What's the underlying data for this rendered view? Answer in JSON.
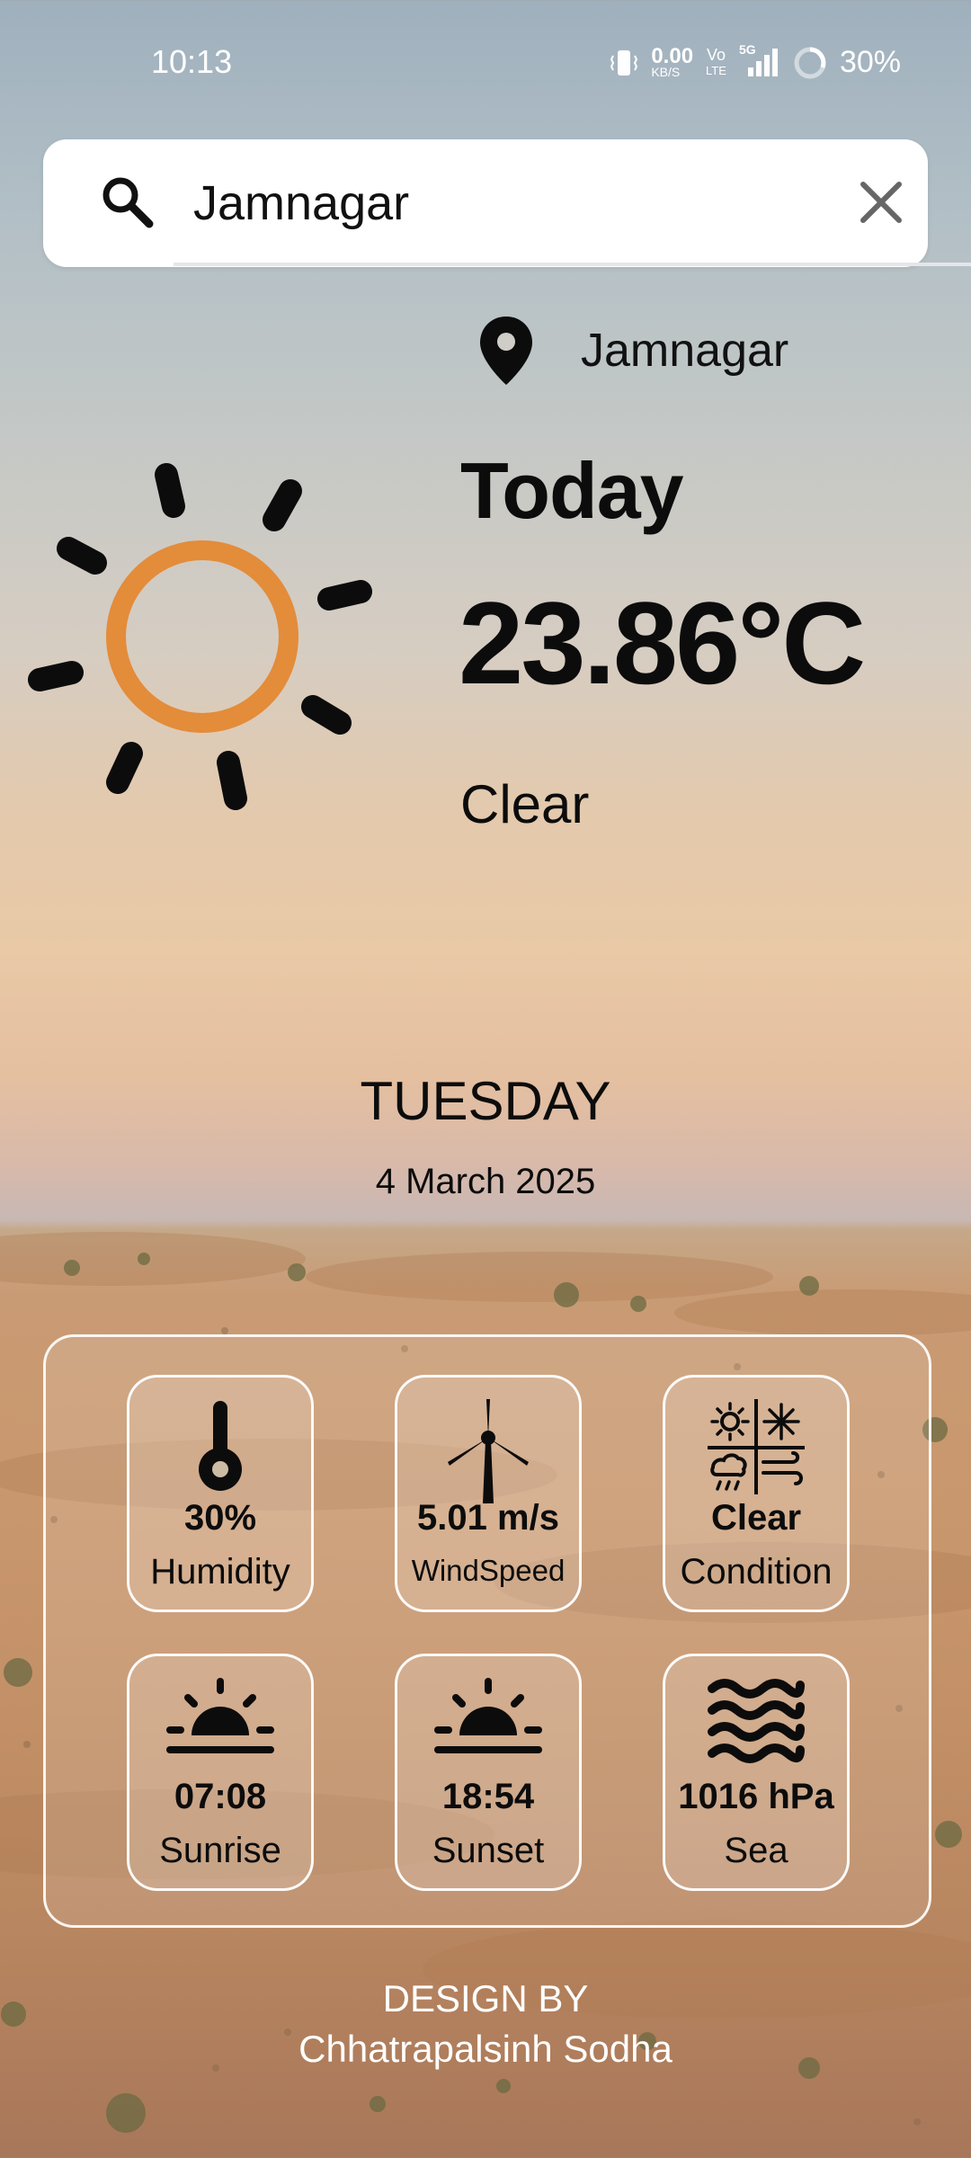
{
  "status_bar": {
    "time": "10:13",
    "net_speed_value": "0.00",
    "net_speed_unit": "KB/S",
    "volte_top": "Vo",
    "volte_bottom": "LTE",
    "network": "5G",
    "battery": "30%"
  },
  "search": {
    "value": "Jamnagar",
    "search_icon": "search-icon",
    "clear_icon": "close-icon"
  },
  "location": {
    "name": "Jamnagar",
    "icon": "location-pin-icon"
  },
  "weather": {
    "icon": "sun-icon",
    "day_label": "Today",
    "temperature": "23.86°C",
    "condition": "Clear"
  },
  "date": {
    "weekday": "TUESDAY",
    "full_date": "4 March 2025"
  },
  "details": [
    {
      "icon": "thermometer-icon",
      "value": "30%",
      "label": "Humidity"
    },
    {
      "icon": "wind-turbine-icon",
      "value": "5.01 m/s",
      "label": "WindSpeed"
    },
    {
      "icon": "weather-conditions-icon",
      "value": "Clear",
      "label": "Condition"
    },
    {
      "icon": "sunrise-icon",
      "value": "07:08",
      "label": "Sunrise"
    },
    {
      "icon": "sunset-icon",
      "value": "18:54",
      "label": "Sunset"
    },
    {
      "icon": "waves-icon",
      "value": "1016 hPa",
      "label": "Sea"
    }
  ],
  "footer": {
    "line1": "DESIGN BY",
    "line2": "Chhatrapalsinh Sodha"
  },
  "colors": {
    "sun": "#e38c3a",
    "text": "#0c0c0c",
    "card_border": "#ffffff"
  }
}
